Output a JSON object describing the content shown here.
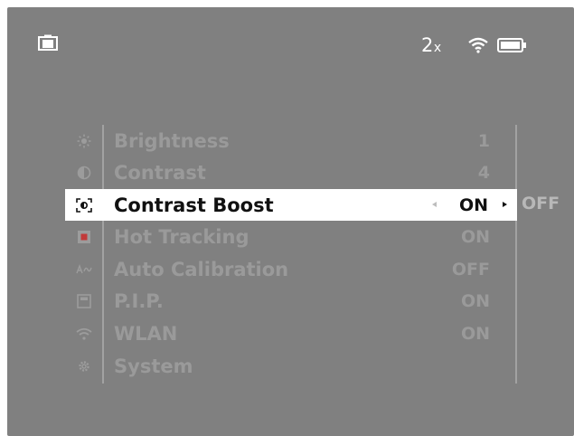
{
  "status_bar": {
    "left_icon": "camera-icon",
    "zoom_number": "2",
    "zoom_suffix": "x",
    "wifi_icon": "wifi-icon",
    "battery_icon": "battery-icon"
  },
  "menu": {
    "items": [
      {
        "label": "Brightness",
        "value": "1",
        "icon": "brightness-icon",
        "selected": false
      },
      {
        "label": "Contrast",
        "value": "4",
        "icon": "contrast-icon",
        "selected": false
      },
      {
        "label": "Contrast Boost",
        "value": "ON",
        "icon": "contrast-boost-icon",
        "selected": true
      },
      {
        "label": "Hot Tracking",
        "value": "ON",
        "icon": "hot-tracking-icon",
        "selected": false
      },
      {
        "label": "Auto Calibration",
        "value": "OFF",
        "icon": "auto-calibration-icon",
        "selected": false
      },
      {
        "label": "P.I.P.",
        "value": "ON",
        "icon": "pip-icon",
        "selected": false
      },
      {
        "label": "WLAN",
        "value": "ON",
        "icon": "wlan-icon",
        "selected": false
      },
      {
        "label": "System",
        "value": "",
        "icon": "system-gear-icon",
        "selected": false
      }
    ],
    "next_option": "OFF"
  },
  "colors": {
    "screen_bg": "#808080",
    "dim_text": "#9a9a9a",
    "highlight_bg": "#ffffff",
    "highlight_text": "#111111"
  }
}
